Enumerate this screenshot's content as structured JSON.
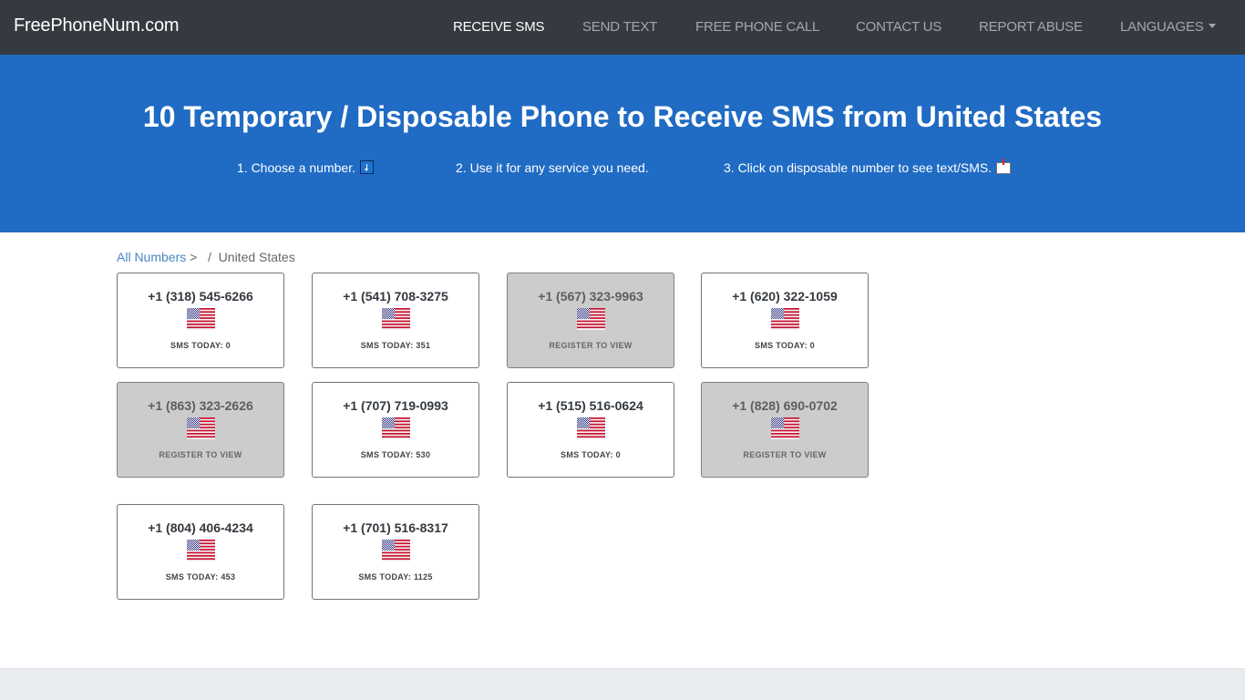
{
  "navbar": {
    "brand": "FreePhoneNum.com",
    "items": [
      {
        "label": "RECEIVE SMS",
        "active": true
      },
      {
        "label": "SEND TEXT",
        "active": false
      },
      {
        "label": "FREE PHONE CALL",
        "active": false
      },
      {
        "label": "CONTACT US",
        "active": false
      },
      {
        "label": "REPORT ABUSE",
        "active": false
      },
      {
        "label": "LANGUAGES",
        "active": false,
        "dropdown": true
      }
    ]
  },
  "hero": {
    "title": "10 Temporary / Disposable Phone to Receive SMS from United States",
    "steps": [
      {
        "text": "1. Choose a number.",
        "icon": "down-arrow-icon"
      },
      {
        "text": "2. Use it for any service you need.",
        "icon": null
      },
      {
        "text": "3. Click on disposable number to see text/SMS.",
        "icon": "inbox-icon"
      }
    ]
  },
  "breadcrumb": {
    "link": "All Numbers",
    "separator": ">",
    "divider": "/",
    "current": "United States"
  },
  "numbers": [
    {
      "number": "+1 (318) 545-6266",
      "status": "SMS TODAY: 0",
      "locked": false
    },
    {
      "number": "+1 (541) 708-3275",
      "status": "SMS TODAY: 351",
      "locked": false
    },
    {
      "number": "+1 (567) 323-9963",
      "status": "REGISTER TO VIEW",
      "locked": true
    },
    {
      "number": "+1 (620) 322-1059",
      "status": "SMS TODAY: 0",
      "locked": false
    },
    {
      "number": "+1 (863) 323-2626",
      "status": "REGISTER TO VIEW",
      "locked": true
    },
    {
      "number": "+1 (707) 719-0993",
      "status": "SMS TODAY: 530",
      "locked": false
    },
    {
      "number": "+1 (515) 516-0624",
      "status": "SMS TODAY: 0",
      "locked": false
    },
    {
      "number": "+1 (828) 690-0702",
      "status": "REGISTER TO VIEW",
      "locked": true
    },
    {
      "number": "+1 (804) 406-4234",
      "status": "SMS TODAY: 453",
      "locked": false
    },
    {
      "number": "+1 (701) 516-8317",
      "status": "SMS TODAY: 1125",
      "locked": false
    }
  ],
  "colors": {
    "navbar": "#343a40",
    "hero": "#206bc4",
    "link": "#4a86c5",
    "locked_card": "#cccccc",
    "footer": "#e9ecef"
  }
}
